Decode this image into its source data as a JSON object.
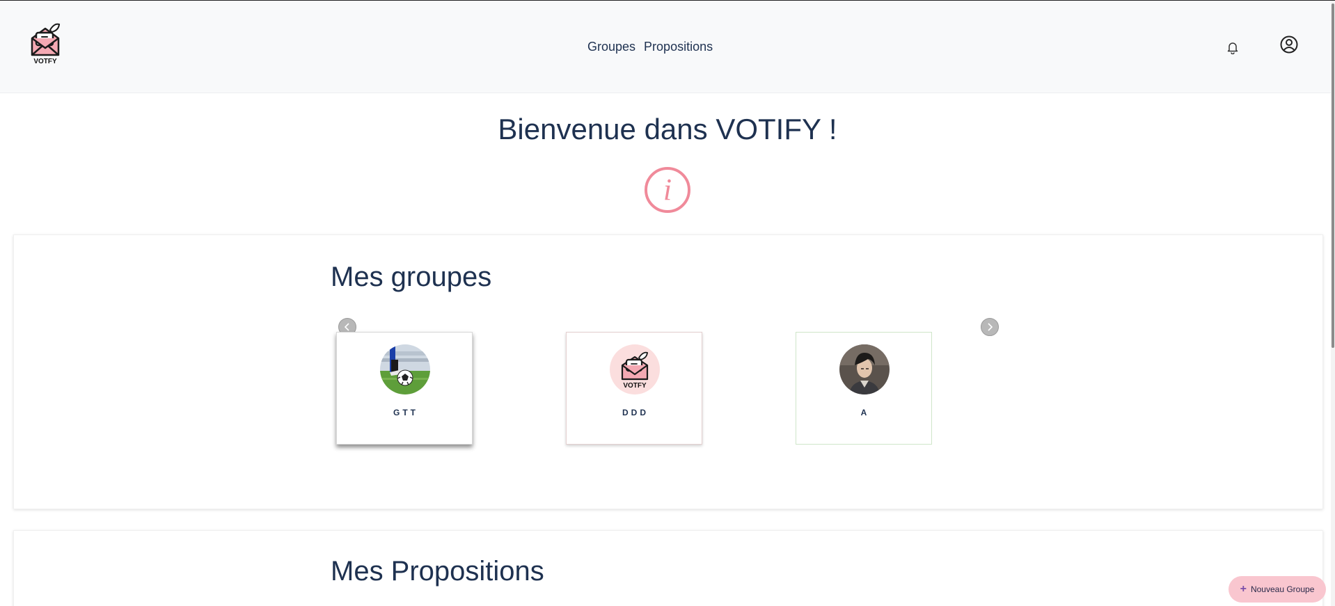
{
  "app": {
    "logo_text": "VOTFY",
    "brand_pink": "#f08a9a",
    "text_navy": "#1e3150"
  },
  "nav": {
    "links": [
      "Groupes",
      "Propositions"
    ],
    "icons": [
      "bell-icon",
      "user-circle-icon"
    ]
  },
  "main": {
    "welcome": "Bienvenue dans VOTIFY !",
    "info_icon": "info-circle-icon"
  },
  "groups_section": {
    "title": "Mes groupes",
    "cards": [
      {
        "label": "GTT",
        "avatar": "soccer-photo"
      },
      {
        "label": "DDD",
        "avatar": "votfy-logo"
      },
      {
        "label": "A",
        "avatar": "person-portrait"
      }
    ]
  },
  "props_section": {
    "title": "Mes Propositions"
  },
  "fab": {
    "label": "Nouveau Groupe",
    "icon": "plus-icon"
  }
}
